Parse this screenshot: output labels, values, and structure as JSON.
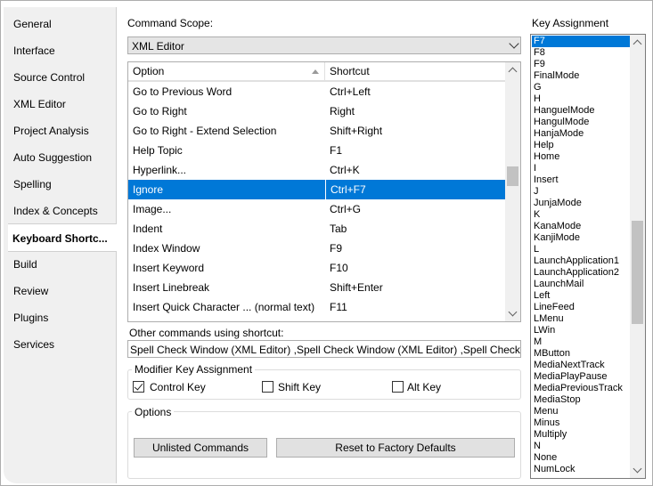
{
  "tabs": [
    {
      "label": "General"
    },
    {
      "label": "Interface"
    },
    {
      "label": "Source Control"
    },
    {
      "label": "XML Editor"
    },
    {
      "label": "Project Analysis"
    },
    {
      "label": "Auto Suggestion"
    },
    {
      "label": "Spelling"
    },
    {
      "label": "Index & Concepts"
    },
    {
      "label": "Keyboard Shortc..."
    },
    {
      "label": "Build"
    },
    {
      "label": "Review"
    },
    {
      "label": "Plugins"
    },
    {
      "label": "Services"
    }
  ],
  "active_tab": "Keyboard Shortc...",
  "command_scope": {
    "label": "Command Scope:",
    "value": "XML Editor"
  },
  "grid": {
    "col_option": "Option",
    "col_shortcut": "Shortcut",
    "rows": [
      {
        "option": "Go to Previous Word",
        "shortcut": "Ctrl+Left"
      },
      {
        "option": "Go to Right",
        "shortcut": "Right"
      },
      {
        "option": "Go to Right - Extend Selection",
        "shortcut": "Shift+Right"
      },
      {
        "option": "Help Topic",
        "shortcut": "F1"
      },
      {
        "option": "Hyperlink...",
        "shortcut": "Ctrl+K"
      },
      {
        "option": "Ignore",
        "shortcut": "Ctrl+F7"
      },
      {
        "option": "Image...",
        "shortcut": "Ctrl+G"
      },
      {
        "option": "Indent",
        "shortcut": "Tab"
      },
      {
        "option": "Index Window",
        "shortcut": "F9"
      },
      {
        "option": "Insert Keyword",
        "shortcut": "F10"
      },
      {
        "option": "Insert Linebreak",
        "shortcut": "Shift+Enter"
      },
      {
        "option": "Insert Quick Character ...   (normal text)",
        "shortcut": "F11"
      }
    ],
    "selected_row": "Ignore"
  },
  "other_commands": {
    "label": "Other commands using shortcut:",
    "value": "Spell Check Window (XML Editor) ,Spell Check Window (XML Editor) ,Spell Check Window (XM"
  },
  "modifier": {
    "title": "Modifier Key Assignment",
    "control_label": "Control Key",
    "control_checked": true,
    "shift_label": "Shift Key",
    "shift_checked": false,
    "alt_label": "Alt Key",
    "alt_checked": false
  },
  "options": {
    "title": "Options",
    "unlisted_label": "Unlisted Commands",
    "reset_label": "Reset to Factory Defaults"
  },
  "key_assignment": {
    "label": "Key Assignment",
    "items": [
      "F7",
      "F8",
      "F9",
      "FinalMode",
      "G",
      "H",
      "HanguelMode",
      "HangulMode",
      "HanjaMode",
      "Help",
      "Home",
      "I",
      "Insert",
      "J",
      "JunjaMode",
      "K",
      "KanaMode",
      "KanjiMode",
      "L",
      "LaunchApplication1",
      "LaunchApplication2",
      "LaunchMail",
      "Left",
      "LineFeed",
      "LMenu",
      "LWin",
      "M",
      "MButton",
      "MediaNextTrack",
      "MediaPlayPause",
      "MediaPreviousTrack",
      "MediaStop",
      "Menu",
      "Minus",
      "Multiply",
      "N",
      "None",
      "NumLock"
    ],
    "selected": "F7"
  },
  "colors": {
    "selection": "#0078d7",
    "tab_bg": "#f0f0f0"
  }
}
